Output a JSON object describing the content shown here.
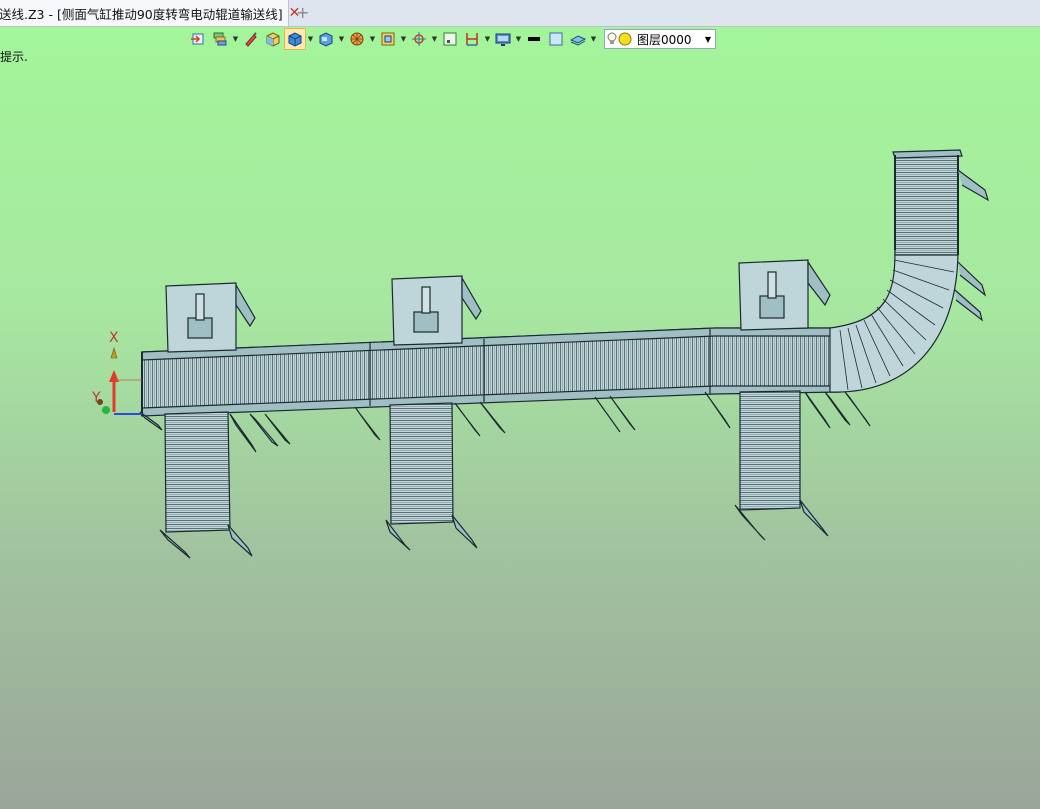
{
  "tab": {
    "title": "送线.Z3 - [侧面气缸推动90度转弯电动辊道输送线]",
    "close_glyph": "✕",
    "add_glyph": "+"
  },
  "viewport": {
    "hint": "提示."
  },
  "toolbar": {
    "items": [
      "exit-sketch-icon",
      "layers-icon",
      "paint-icon",
      "box-icon",
      "shaded-view-icon",
      "display-mode-icon",
      "sphere-icon",
      "frame-icon",
      "snap-icon",
      "point-icon",
      "dimension-icon",
      "screen-icon",
      "line-color-icon",
      "fill-color-icon",
      "plane-icon"
    ],
    "layer": "图层0000"
  },
  "axes": {
    "x_label": "X",
    "y_label": "Y"
  },
  "colors": {
    "background_top": "#a3f59a",
    "background_bottom": "#9aa59a",
    "model": "#b9d2d6",
    "edge": "#1b2a30",
    "axis_x": "#e23a2a",
    "axis_y": "#2ab33a",
    "axis_z": "#2a4ae0"
  }
}
